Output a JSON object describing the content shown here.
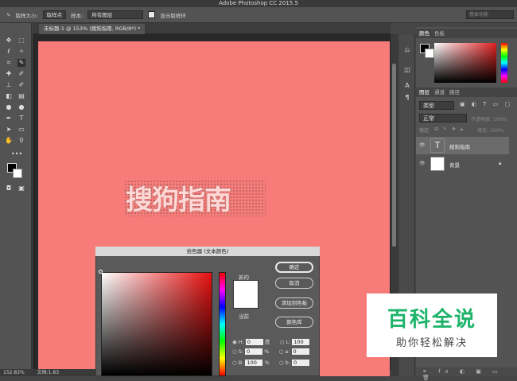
{
  "app": {
    "title": "Adobe Photoshop CC 2015.5"
  },
  "options": {
    "sample_size_label": "取样大小:",
    "sample_size_value": "取样点",
    "sample_label": "样本:",
    "sample_value": "所有图层",
    "show_ring_label": "显示取样环",
    "workspace": "基本功能"
  },
  "document": {
    "tab_title": "未标题-1 @ 153% (搜狗指南, RGB/8*) *"
  },
  "canvas": {
    "text": "搜狗指南",
    "bg_color": "#f77c79"
  },
  "status": {
    "zoom": "152.83%",
    "doc": "文档:1.83"
  },
  "panels": {
    "color_tabs": [
      "颜色",
      "色板"
    ],
    "layer_tabs": [
      "图层",
      "通道",
      "路径"
    ],
    "kind": "类型",
    "blend": "正常",
    "opacity": "不透明度: 100%",
    "lock": "锁定:",
    "fill": "填充: 100%",
    "layers": [
      {
        "name": "搜狗指南",
        "type": "text",
        "thumb": "T"
      },
      {
        "name": "背景",
        "type": "background"
      }
    ]
  },
  "dialog": {
    "title": "拾色器 (文本颜色)",
    "new_label": "新的",
    "current_label": "当前",
    "buttons": {
      "ok": "确定",
      "cancel": "取消",
      "add_swatch": "添加到色板",
      "library": "颜色库"
    },
    "fields": [
      {
        "label": "H:",
        "value": "0",
        "unit": "度",
        "label2": "L:",
        "value2": "100"
      },
      {
        "label": "S:",
        "value": "0",
        "unit": "%",
        "label2": "a:",
        "value2": "0"
      },
      {
        "label": "B:",
        "value": "100",
        "unit": "%",
        "label2": "b:",
        "value2": "0"
      }
    ]
  },
  "watermark": {
    "line1": "百科全说",
    "line2": "助你轻松解决",
    "color": "#1db36a"
  }
}
